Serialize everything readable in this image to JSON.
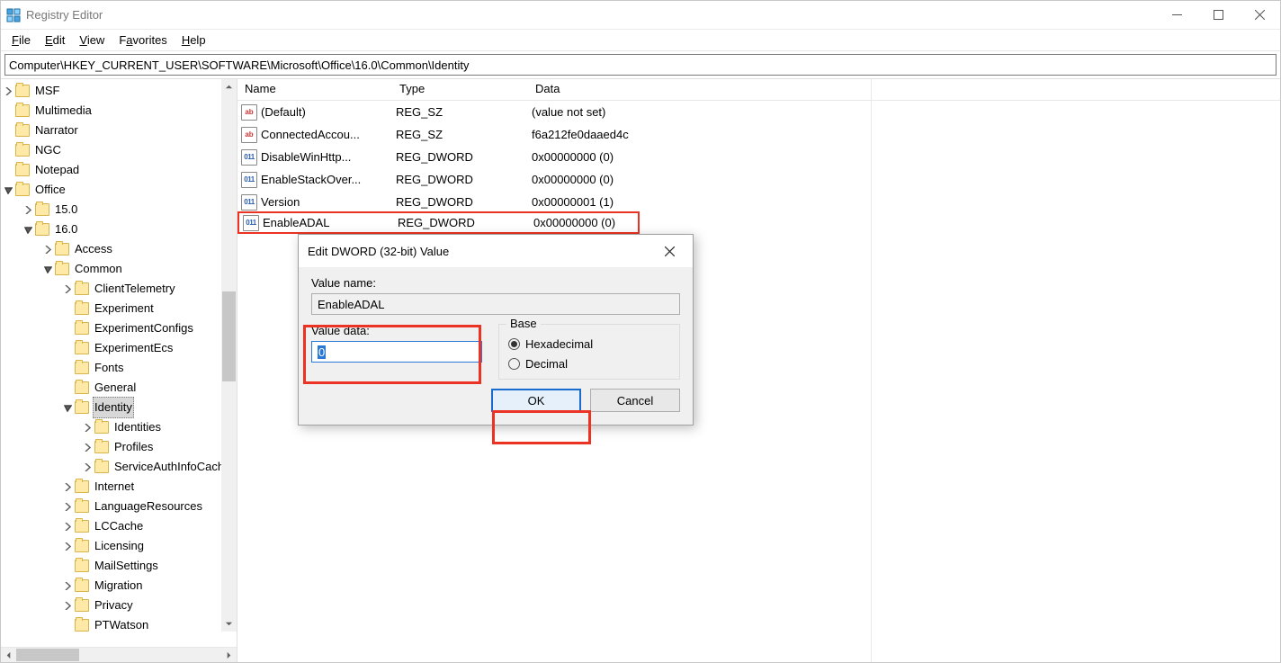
{
  "titlebar": {
    "title": "Registry Editor"
  },
  "menu": {
    "file": "File",
    "edit": "Edit",
    "view": "View",
    "favorites": "Favorites",
    "help": "Help"
  },
  "address": "Computer\\HKEY_CURRENT_USER\\SOFTWARE\\Microsoft\\Office\\16.0\\Common\\Identity",
  "tree": [
    {
      "d": 0,
      "exp": "closed",
      "label": "MSF"
    },
    {
      "d": 0,
      "exp": "none",
      "label": "Multimedia"
    },
    {
      "d": 0,
      "exp": "none",
      "label": "Narrator"
    },
    {
      "d": 0,
      "exp": "none",
      "label": "NGC"
    },
    {
      "d": 0,
      "exp": "none",
      "label": "Notepad"
    },
    {
      "d": 0,
      "exp": "open",
      "label": "Office"
    },
    {
      "d": 1,
      "exp": "closed",
      "label": "15.0"
    },
    {
      "d": 1,
      "exp": "open",
      "label": "16.0"
    },
    {
      "d": 2,
      "exp": "closed",
      "label": "Access"
    },
    {
      "d": 2,
      "exp": "open",
      "label": "Common"
    },
    {
      "d": 3,
      "exp": "closed",
      "label": "ClientTelemetry"
    },
    {
      "d": 3,
      "exp": "none",
      "label": "Experiment"
    },
    {
      "d": 3,
      "exp": "none",
      "label": "ExperimentConfigs"
    },
    {
      "d": 3,
      "exp": "none",
      "label": "ExperimentEcs"
    },
    {
      "d": 3,
      "exp": "none",
      "label": "Fonts"
    },
    {
      "d": 3,
      "exp": "none",
      "label": "General"
    },
    {
      "d": 3,
      "exp": "open",
      "label": "Identity",
      "selected": true
    },
    {
      "d": 4,
      "exp": "closed",
      "label": "Identities"
    },
    {
      "d": 4,
      "exp": "closed",
      "label": "Profiles"
    },
    {
      "d": 4,
      "exp": "closed",
      "label": "ServiceAuthInfoCache"
    },
    {
      "d": 3,
      "exp": "closed",
      "label": "Internet"
    },
    {
      "d": 3,
      "exp": "closed",
      "label": "LanguageResources"
    },
    {
      "d": 3,
      "exp": "closed",
      "label": "LCCache"
    },
    {
      "d": 3,
      "exp": "closed",
      "label": "Licensing"
    },
    {
      "d": 3,
      "exp": "none",
      "label": "MailSettings"
    },
    {
      "d": 3,
      "exp": "closed",
      "label": "Migration"
    },
    {
      "d": 3,
      "exp": "closed",
      "label": "Privacy"
    },
    {
      "d": 3,
      "exp": "none",
      "label": "PTWatson"
    }
  ],
  "list": {
    "headers": {
      "name": "Name",
      "type": "Type",
      "data": "Data"
    },
    "rows": [
      {
        "icon": "sz",
        "name": "(Default)",
        "type": "REG_SZ",
        "data": "(value not set)"
      },
      {
        "icon": "sz",
        "name": "ConnectedAccou...",
        "type": "REG_SZ",
        "data": "f6a212fe0daaed4c"
      },
      {
        "icon": "dw",
        "name": "DisableWinHttp...",
        "type": "REG_DWORD",
        "data": "0x00000000 (0)"
      },
      {
        "icon": "dw",
        "name": "EnableStackOver...",
        "type": "REG_DWORD",
        "data": "0x00000000 (0)"
      },
      {
        "icon": "dw",
        "name": "Version",
        "type": "REG_DWORD",
        "data": "0x00000001 (1)"
      },
      {
        "icon": "dw",
        "name": "EnableADAL",
        "type": "REG_DWORD",
        "data": "0x00000000 (0)",
        "highlight": true
      }
    ]
  },
  "dialog": {
    "title": "Edit DWORD (32-bit) Value",
    "value_name_label": "Value name:",
    "value_name": "EnableADAL",
    "value_data_label": "Value data:",
    "value_data": "0",
    "base_label": "Base",
    "hex": "Hexadecimal",
    "dec": "Decimal",
    "ok": "OK",
    "cancel": "Cancel"
  }
}
